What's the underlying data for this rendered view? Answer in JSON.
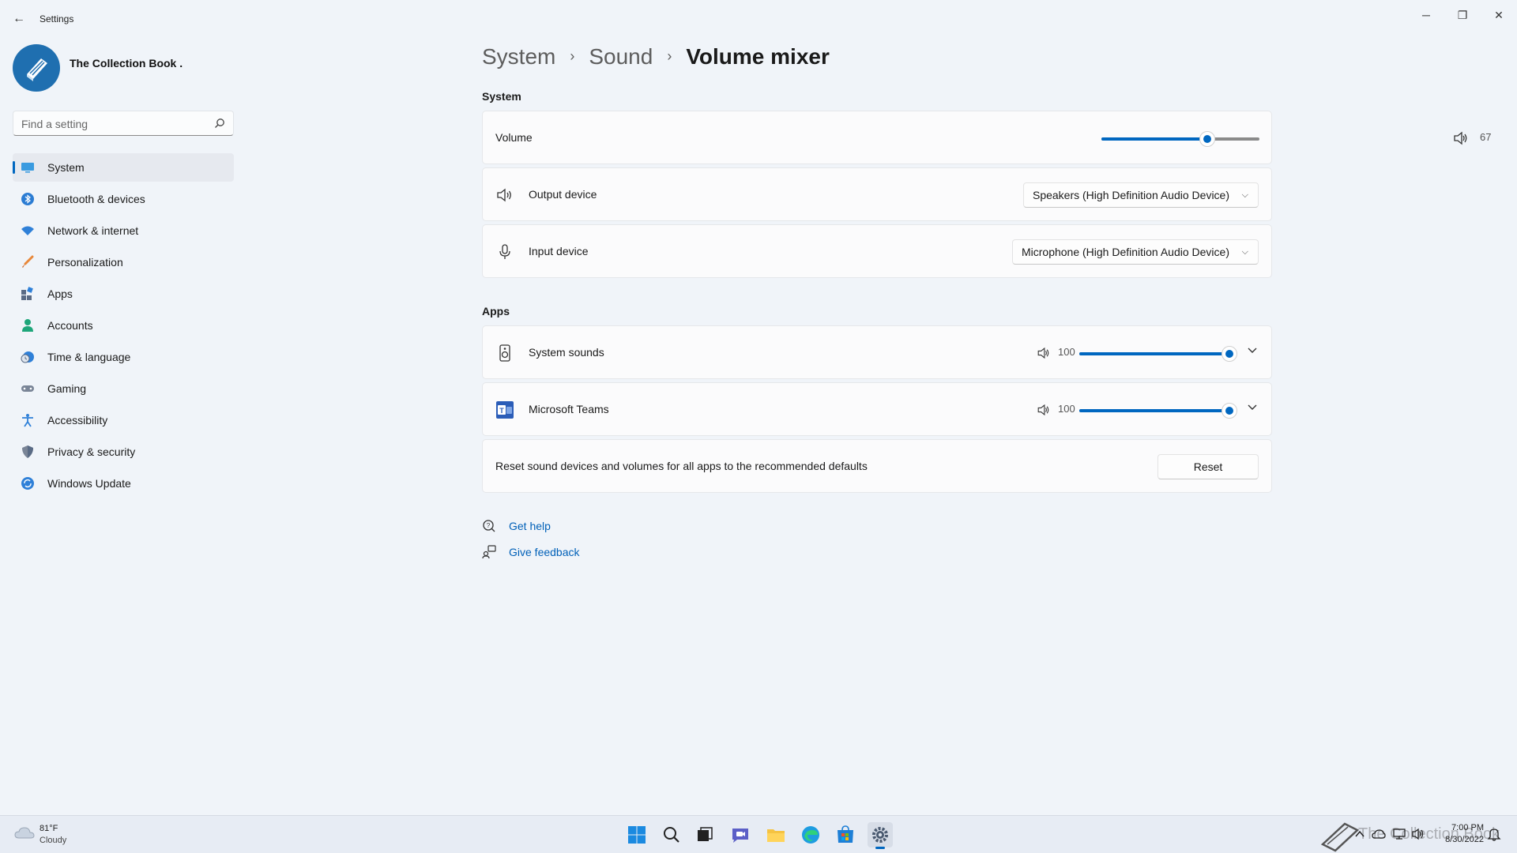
{
  "window": {
    "title": "Settings",
    "minimize_glyph": "─",
    "maximize_glyph": "❐",
    "close_glyph": "✕",
    "back_glyph": "←"
  },
  "profile": {
    "name": "The Collection Book ."
  },
  "search": {
    "placeholder": "Find a setting",
    "value": ""
  },
  "nav": {
    "items": [
      {
        "label": "System",
        "icon": "monitor-icon",
        "active": true
      },
      {
        "label": "Bluetooth & devices",
        "icon": "bluetooth-icon"
      },
      {
        "label": "Network & internet",
        "icon": "wifi-icon"
      },
      {
        "label": "Personalization",
        "icon": "brush-icon"
      },
      {
        "label": "Apps",
        "icon": "apps-icon"
      },
      {
        "label": "Accounts",
        "icon": "person-icon"
      },
      {
        "label": "Time & language",
        "icon": "clock-globe-icon"
      },
      {
        "label": "Gaming",
        "icon": "gamepad-icon"
      },
      {
        "label": "Accessibility",
        "icon": "accessibility-icon"
      },
      {
        "label": "Privacy & security",
        "icon": "shield-icon"
      },
      {
        "label": "Windows Update",
        "icon": "update-icon"
      }
    ]
  },
  "breadcrumb": {
    "items": [
      "System",
      "Sound",
      "Volume mixer"
    ],
    "separator": "›"
  },
  "system_section": {
    "heading": "System",
    "volume": {
      "label": "Volume",
      "value": "67",
      "level": 0.67
    },
    "output": {
      "label": "Output device",
      "selected": "Speakers (High Definition Audio Device)"
    },
    "input": {
      "label": "Input device",
      "selected": "Microphone (High Definition Audio Device)"
    }
  },
  "apps_section": {
    "heading": "Apps",
    "apps": [
      {
        "label": "System sounds",
        "value": "100",
        "level": 1.0,
        "icon": "speaker-device-icon"
      },
      {
        "label": "Microsoft Teams",
        "value": "100",
        "level": 1.0,
        "icon": "teams-icon"
      }
    ],
    "reset": {
      "text": "Reset sound devices and volumes for all apps to the recommended defaults",
      "button": "Reset"
    }
  },
  "help": {
    "get_help": "Get help",
    "give_feedback": "Give feedback"
  },
  "taskbar": {
    "weather_temp": "81°F",
    "weather_desc": "Cloudy",
    "time": "7:00 PM",
    "date": "8/30/2022",
    "watermark": "The Collection Book"
  },
  "colors": {
    "accent": "#0067c0",
    "link": "#0060b8",
    "background": "#f0f4f9",
    "card": "#fbfbfc"
  }
}
